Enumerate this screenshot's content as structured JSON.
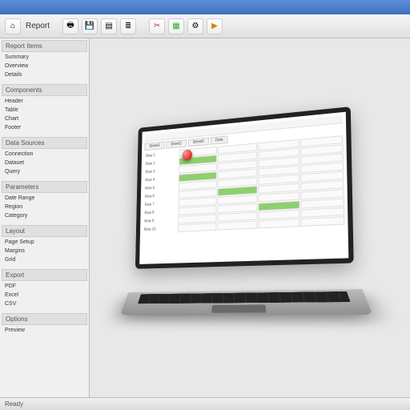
{
  "titlebar": {
    "title": ""
  },
  "toolbar": {
    "report_label": "Report",
    "icons": [
      "home",
      "print",
      "save",
      "chart",
      "cut",
      "grid",
      "gear",
      "play"
    ]
  },
  "sidebar": {
    "groups": [
      {
        "header": "Report Items",
        "items": [
          "Summary",
          "Overview",
          "Details"
        ]
      },
      {
        "header": "Components",
        "items": [
          "Header",
          "Table",
          "Chart",
          "Footer"
        ]
      },
      {
        "header": "Data Sources",
        "items": [
          "Connection",
          "Dataset",
          "Query"
        ]
      },
      {
        "header": "Parameters",
        "items": [
          "Date Range",
          "Region",
          "Category"
        ]
      },
      {
        "header": "Layout",
        "items": [
          "Page Setup",
          "Margins",
          "Grid"
        ]
      },
      {
        "header": "Export",
        "items": [
          "PDF",
          "Excel",
          "CSV"
        ]
      },
      {
        "header": "Options",
        "items": [
          "Preview"
        ]
      }
    ]
  },
  "laptop_screen": {
    "tabs": [
      "Sheet1",
      "Sheet2",
      "Sheet3",
      "Data"
    ],
    "rows": [
      "Row 1",
      "Row 2",
      "Row 3",
      "Row 4",
      "Row 5",
      "Row 6",
      "Row 7",
      "Row 8",
      "Row 9",
      "Row 10"
    ],
    "highlights": [
      [
        1,
        0
      ],
      [
        3,
        0
      ],
      [
        5,
        1
      ],
      [
        7,
        2
      ]
    ]
  },
  "statusbar": {
    "left": "Ready",
    "right": ""
  }
}
